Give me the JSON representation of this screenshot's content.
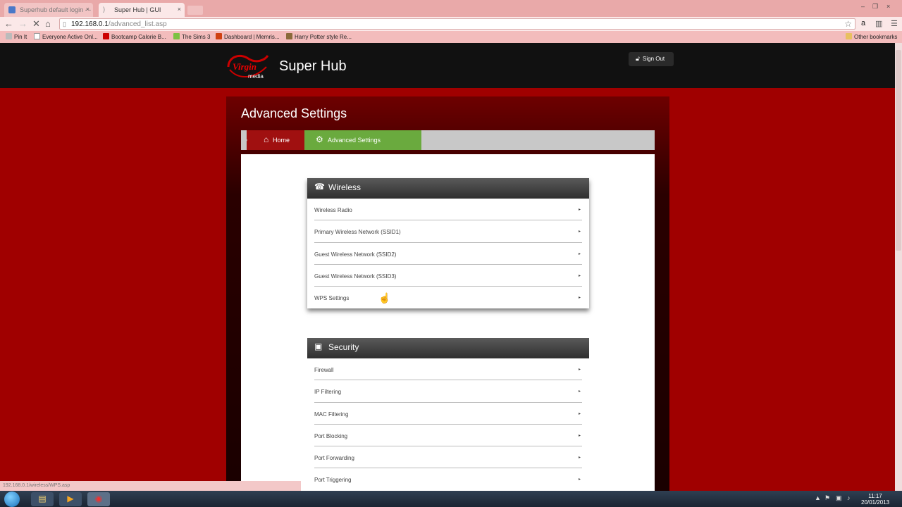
{
  "browser": {
    "tabs": [
      {
        "title": "Superhub default login - -",
        "active": false
      },
      {
        "title": "Super Hub | GUI",
        "active": true
      }
    ],
    "close_glyph": "×",
    "window_controls": [
      "–",
      "❐",
      "×"
    ],
    "url_host": "192.168.0.1",
    "url_path": "/advanced_list.asp",
    "bookmarks": [
      {
        "label": "Pin It",
        "icon": "pin-icon",
        "color": "#bbbbbb"
      },
      {
        "label": "Everyone Active Onl...",
        "icon": "page-icon",
        "color": "#ffffff"
      },
      {
        "label": "Bootcamp Calorie B...",
        "icon": "youtube-icon",
        "color": "#cc0000"
      },
      {
        "label": "The Sims 3",
        "icon": "sims-icon",
        "color": "#7cc242"
      },
      {
        "label": "Dashboard | Memris...",
        "icon": "memrise-icon",
        "color": "#d04010"
      },
      {
        "label": "Harry Potter style Re...",
        "icon": "bookmark-icon",
        "color": "#8a6a3a"
      }
    ],
    "other_bookmarks": "Other bookmarks",
    "status_text": "192.168.0.1/wireless/WPS.asp"
  },
  "header": {
    "logo_text": "Virgin",
    "logo_sub": "media",
    "title": "Super Hub",
    "sign_out": "Sign Out"
  },
  "page": {
    "title": "Advanced Settings",
    "breadcrumb": {
      "home": "Home",
      "current": "Advanced Settings"
    }
  },
  "sections": [
    {
      "title": "Wireless",
      "icon": "wireless-icon",
      "items": [
        "Wireless Radio",
        "Primary Wireless Network (SSID1)",
        "Guest Wireless Network (SSID2)",
        "Guest Wireless Network (SSID3)",
        "WPS Settings"
      ]
    },
    {
      "title": "Security",
      "icon": "monitor-icon",
      "items": [
        "Firewall",
        "IP Filtering",
        "MAC Filtering",
        "Port Blocking",
        "Port Forwarding",
        "Port Triggering"
      ]
    }
  ],
  "taskbar": {
    "time": "11:17",
    "date": "20/01/2013"
  },
  "colors": {
    "page_bg": "#a00000",
    "header_bg": "#111111",
    "crumb_home": "#a01010",
    "crumb_active": "#6aaa3e",
    "tab_strip": "#e9a9a9"
  }
}
